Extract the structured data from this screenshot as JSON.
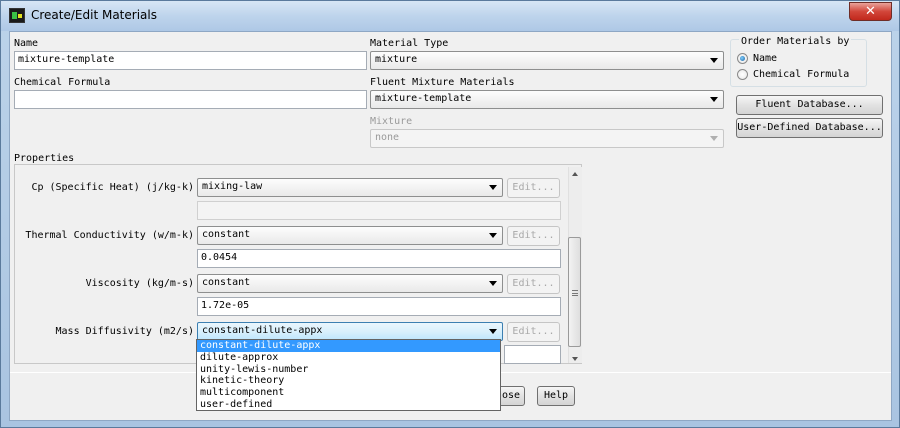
{
  "window": {
    "title": "Create/Edit Materials",
    "close_glyph": "✕"
  },
  "name": {
    "label": "Name",
    "value": "mixture-template"
  },
  "formula": {
    "label": "Chemical Formula",
    "value": ""
  },
  "material_type": {
    "label": "Material Type",
    "value": "mixture"
  },
  "fluent_mixture": {
    "label": "Fluent Mixture Materials",
    "value": "mixture-template"
  },
  "mixture": {
    "label": "Mixture",
    "value": "none"
  },
  "order": {
    "title": "Order Materials by",
    "options": [
      "Name",
      "Chemical Formula"
    ],
    "selected": "Name"
  },
  "buttons": {
    "fluent_db": "Fluent Database...",
    "user_db": "User-Defined Database...",
    "close_partial": "ose",
    "help": "Help"
  },
  "properties": {
    "label": "Properties",
    "rows": [
      {
        "label": "Cp (Specific Heat) (j/kg-k)",
        "method": "mixing-law",
        "value": "",
        "edit": "Edit..."
      },
      {
        "label": "Thermal Conductivity (w/m-k)",
        "method": "constant",
        "value": "0.0454",
        "edit": "Edit..."
      },
      {
        "label": "Viscosity (kg/m-s)",
        "method": "constant",
        "value": "1.72e-05",
        "edit": "Edit..."
      },
      {
        "label": "Mass Diffusivity (m2/s)",
        "method": "constant-dilute-appx",
        "value": "",
        "edit": "Edit..."
      }
    ]
  },
  "dropdown": {
    "items": [
      "constant-dilute-appx",
      "dilute-approx",
      "unity-lewis-number",
      "kinetic-theory",
      "multicomponent",
      "user-defined"
    ],
    "highlighted": "constant-dilute-appx"
  }
}
